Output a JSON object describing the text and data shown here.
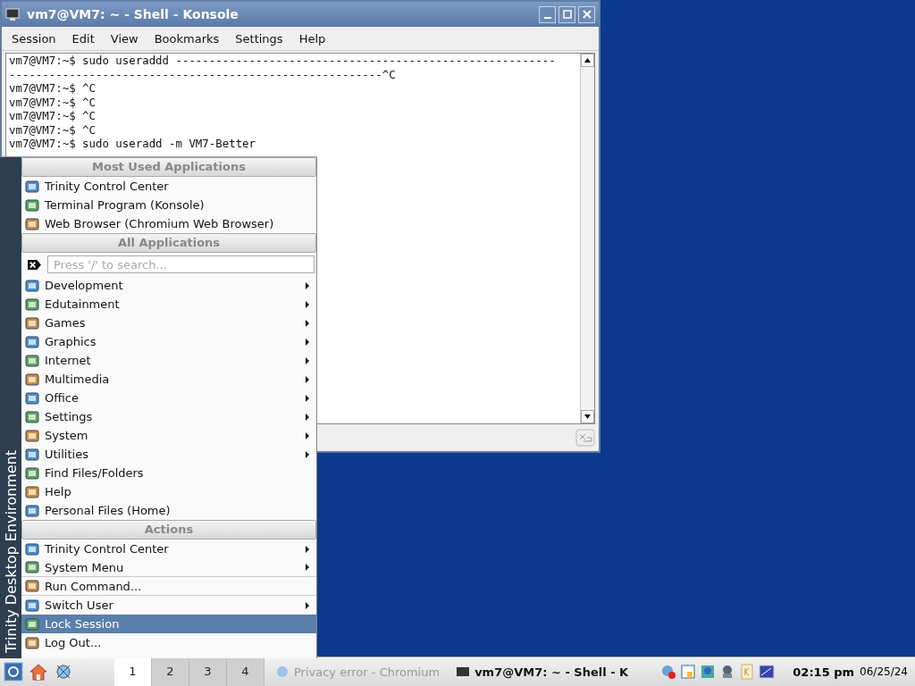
{
  "window": {
    "title": "vm7@VM7: ~ - Shell - Konsole"
  },
  "menubar": [
    "Session",
    "Edit",
    "View",
    "Bookmarks",
    "Settings",
    "Help"
  ],
  "terminal": {
    "lines": [
      "vm7@VM7:~$ sudo useraddd ---------------------------------------------------------",
      "--------------------------------------------------------^C",
      "vm7@VM7:~$ ^C",
      "vm7@VM7:~$ ^C",
      "vm7@VM7:~$ ^C",
      "vm7@VM7:~$ ^C",
      "vm7@VM7:~$ sudo useradd -m VM7-Better"
    ]
  },
  "start_menu": {
    "side_title": "Trinity Desktop Environment",
    "sections": [
      {
        "title": "Most Used Applications",
        "items": [
          {
            "label": "Trinity Control Center",
            "submenu": false,
            "selected": false,
            "divider": false
          },
          {
            "label": "Terminal Program (Konsole)",
            "submenu": false,
            "selected": false,
            "divider": false
          },
          {
            "label": "Web Browser (Chromium Web Browser)",
            "submenu": false,
            "selected": false,
            "divider": false
          }
        ]
      },
      {
        "title": "All Applications",
        "search_placeholder": "Press '/' to search...",
        "items": [
          {
            "label": "Development",
            "submenu": true,
            "selected": false,
            "divider": false
          },
          {
            "label": "Edutainment",
            "submenu": true,
            "selected": false,
            "divider": false
          },
          {
            "label": "Games",
            "submenu": true,
            "selected": false,
            "divider": false
          },
          {
            "label": "Graphics",
            "submenu": true,
            "selected": false,
            "divider": false
          },
          {
            "label": "Internet",
            "submenu": true,
            "selected": false,
            "divider": false
          },
          {
            "label": "Multimedia",
            "submenu": true,
            "selected": false,
            "divider": false
          },
          {
            "label": "Office",
            "submenu": true,
            "selected": false,
            "divider": false
          },
          {
            "label": "Settings",
            "submenu": true,
            "selected": false,
            "divider": false
          },
          {
            "label": "System",
            "submenu": true,
            "selected": false,
            "divider": false
          },
          {
            "label": "Utilities",
            "submenu": true,
            "selected": false,
            "divider": false
          },
          {
            "label": "Find Files/Folders",
            "submenu": false,
            "selected": false,
            "divider": false
          },
          {
            "label": "Help",
            "submenu": false,
            "selected": false,
            "divider": false
          },
          {
            "label": "Personal Files (Home)",
            "submenu": false,
            "selected": false,
            "divider": false
          }
        ]
      },
      {
        "title": "Actions",
        "items": [
          {
            "label": "Trinity Control Center",
            "submenu": true,
            "selected": false,
            "divider": false
          },
          {
            "label": "System Menu",
            "submenu": true,
            "selected": false,
            "divider": true
          },
          {
            "label": "Run Command...",
            "submenu": false,
            "selected": false,
            "divider": true
          },
          {
            "label": "Switch User",
            "submenu": true,
            "selected": false,
            "divider": false
          },
          {
            "label": "Lock Session",
            "submenu": false,
            "selected": true,
            "divider": false
          },
          {
            "label": "Log Out...",
            "submenu": false,
            "selected": false,
            "divider": false
          }
        ]
      }
    ]
  },
  "taskbar": {
    "desktops": [
      {
        "label": "1",
        "selected": true
      },
      {
        "label": "2",
        "selected": false
      },
      {
        "label": "3",
        "selected": false
      },
      {
        "label": "4",
        "selected": false
      }
    ],
    "tasks": [
      {
        "label": "Privacy error - Chromium",
        "selected": false
      },
      {
        "label": "vm7@VM7: ~ - Shell - K",
        "selected": true
      }
    ],
    "clock": {
      "time": "02:15 pm",
      "date": "06/25/24"
    }
  }
}
